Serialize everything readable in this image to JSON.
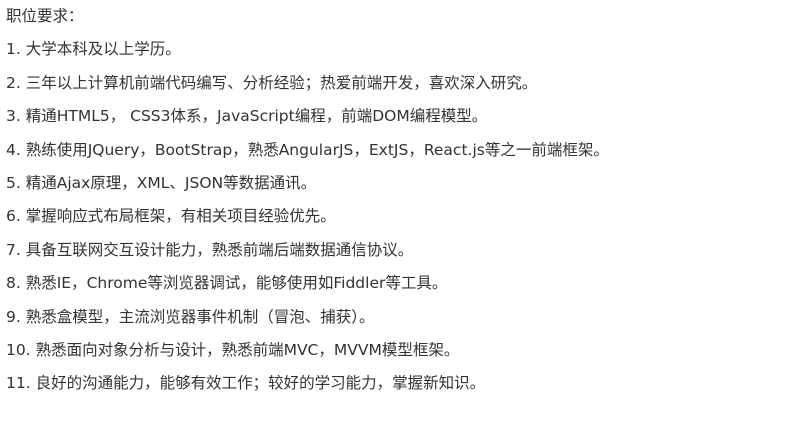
{
  "document": {
    "heading": "职位要求：",
    "items": [
      "1. 大学本科及以上学历。",
      "2. 三年以上计算机前端代码编写、分析经验；热爱前端开发，喜欢深入研究。",
      "3. 精通HTML5， CSS3体系，JavaScript编程，前端DOM编程模型。",
      "4. 熟练使用JQuery，BootStrap，熟悉AngularJS，ExtJS，React.js等之一前端框架。",
      "5. 精通Ajax原理，XML、JSON等数据通讯。",
      "6. 掌握响应式布局框架，有相关项目经验优先。",
      "7. 具备互联网交互设计能力，熟悉前端后端数据通信协议。",
      "8. 熟悉IE，Chrome等浏览器调试，能够使用如Fiddler等工具。",
      "9. 熟悉盒模型，主流浏览器事件机制（冒泡、捕获）。",
      "10. 熟悉面向对象分析与设计，熟悉前端MVC，MVVM模型框架。",
      "11. 良好的沟通能力，能够有效工作；较好的学习能力，掌握新知识。"
    ]
  }
}
